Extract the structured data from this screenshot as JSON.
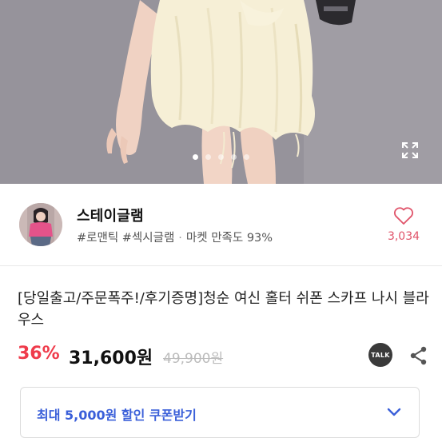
{
  "gallery": {
    "slide_count": 5,
    "active_slide": 1
  },
  "seller": {
    "name": "스테이글램",
    "tags": "#로맨틱 #섹시글램",
    "satisfaction": "마켓 만족도 93%",
    "like_count": "3,034"
  },
  "product": {
    "title": "[당일출고/주문폭주!/후기증명]청순 여신 홀터 쉬폰 스카프 나시 블라우스",
    "discount": "36%",
    "price": "31,600원",
    "original_price": "49,900원",
    "talk_label": "TALK"
  },
  "coupon": {
    "label": "최대 5,000원 할인 쿠폰받기"
  },
  "colors": {
    "discount": "#ef3b4b",
    "like": "#e0546a",
    "coupon": "#3a5fd9"
  }
}
